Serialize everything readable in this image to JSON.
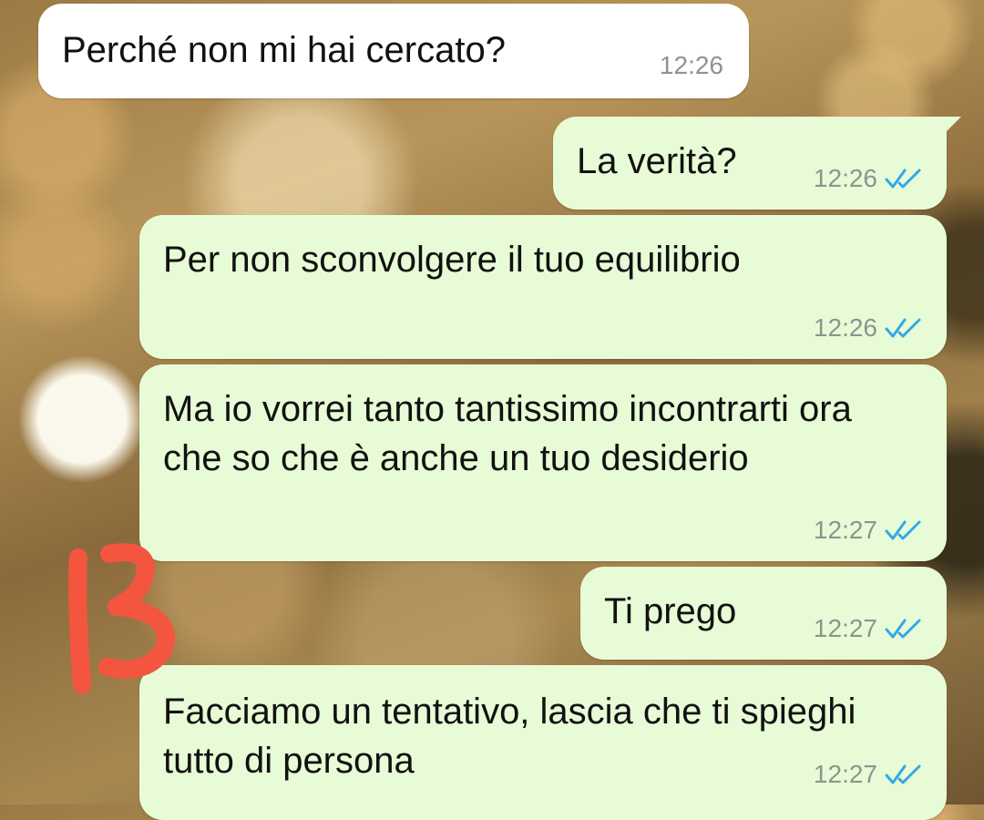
{
  "messages": [
    {
      "id": "m1",
      "direction": "incoming",
      "text": "Perché non mi hai cercato?",
      "time": "12:26"
    },
    {
      "id": "m2",
      "direction": "outgoing",
      "text": "La verità?",
      "time": "12:26",
      "status": "read"
    },
    {
      "id": "m3",
      "direction": "outgoing",
      "text": "Per non sconvolgere il tuo equilibrio",
      "time": "12:26",
      "status": "read"
    },
    {
      "id": "m4",
      "direction": "outgoing",
      "text": "Ma io vorrei tanto tantissimo incontrarti ora che so che è anche un tuo desiderio",
      "time": "12:27",
      "status": "read"
    },
    {
      "id": "m5",
      "direction": "outgoing",
      "text": "Ti prego",
      "time": "12:27",
      "status": "read"
    },
    {
      "id": "m6",
      "direction": "outgoing",
      "text": "Facciamo un tentativo, lascia che ti spieghi tutto di persona",
      "time": "12:27",
      "status": "read"
    }
  ],
  "annotation": {
    "text": "13",
    "color": "#f4553f"
  },
  "colors": {
    "incoming_bubble": "#ffffff",
    "outgoing_bubble": "#e7fcd6",
    "timestamp": "#8d948f",
    "read_ticks": "#35a7e8"
  },
  "icons": {
    "read_receipt": "double-check-icon"
  }
}
